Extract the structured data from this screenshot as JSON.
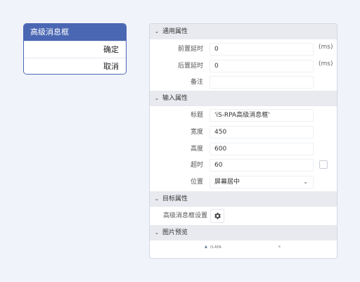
{
  "activity": {
    "title": "高级消息框",
    "buttons": [
      "确定",
      "取消"
    ]
  },
  "panel": {
    "general": {
      "header": "通用属性",
      "pre_delay": {
        "label": "前置延时",
        "value": "0",
        "unit": "(ms)"
      },
      "post_delay": {
        "label": "后置延时",
        "value": "0",
        "unit": "(ms)"
      },
      "note": {
        "label": "备注",
        "value": ""
      }
    },
    "input": {
      "header": "输入属性",
      "title": {
        "label": "标题",
        "value": "'iS-RPA高级消息框'"
      },
      "width": {
        "label": "宽度",
        "value": "450"
      },
      "height": {
        "label": "高度",
        "value": "600"
      },
      "timeout": {
        "label": "超时",
        "value": "60"
      },
      "position": {
        "label": "位置",
        "value": "屏幕居中"
      }
    },
    "target": {
      "header": "目标属性",
      "settings_label": "高级消息框设置"
    },
    "preview": {
      "header": "图片预览",
      "caption": "iS-RPA",
      "close": "x"
    }
  },
  "colors": {
    "accent": "#4a67b3",
    "background": "#f0f3fa",
    "section_header": "#e8eaef"
  },
  "icons": {
    "chevron": "chevron-down-icon",
    "gear": "gear-icon",
    "dropdown": "chevron-down-icon"
  }
}
